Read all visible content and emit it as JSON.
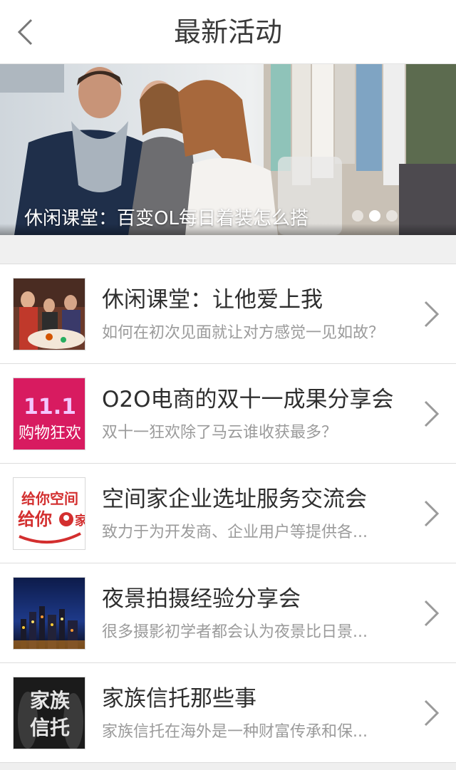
{
  "header": {
    "title": "最新活动",
    "back_icon": "chevron-left-icon"
  },
  "banner": {
    "caption": "休闲课堂：百变OL每日着装怎么搭",
    "slide_count": 3,
    "active_slide": 2
  },
  "activities": [
    {
      "title": "休闲课堂：让他爱上我",
      "subtitle": "如何在初次见面就让对方感觉一见如故？"
    },
    {
      "title": "O2O电商的双十一成果分享会",
      "subtitle": "双十一狂欢除了马云谁收获最多？",
      "thumb_text": [
        "11.1",
        "购物狂欢"
      ]
    },
    {
      "title": "空间家企业选址服务交流会",
      "subtitle": "致力于为开发商、企业用户等提供各...",
      "thumb_text": [
        "给你空间",
        "给你",
        "家"
      ]
    },
    {
      "title": "夜景拍摄经验分享会",
      "subtitle": "很多摄影初学者都会认为夜景比日景..."
    },
    {
      "title": "家族信托那些事",
      "subtitle": "家族信托在海外是一种财富传承和保...",
      "thumb_text": [
        "家族",
        "信托"
      ]
    }
  ],
  "colors": {
    "title_text": "#2e2e2e",
    "subtitle_text": "#9b9b9b",
    "background": "#f0f0f0",
    "divider": "#dddddd"
  }
}
